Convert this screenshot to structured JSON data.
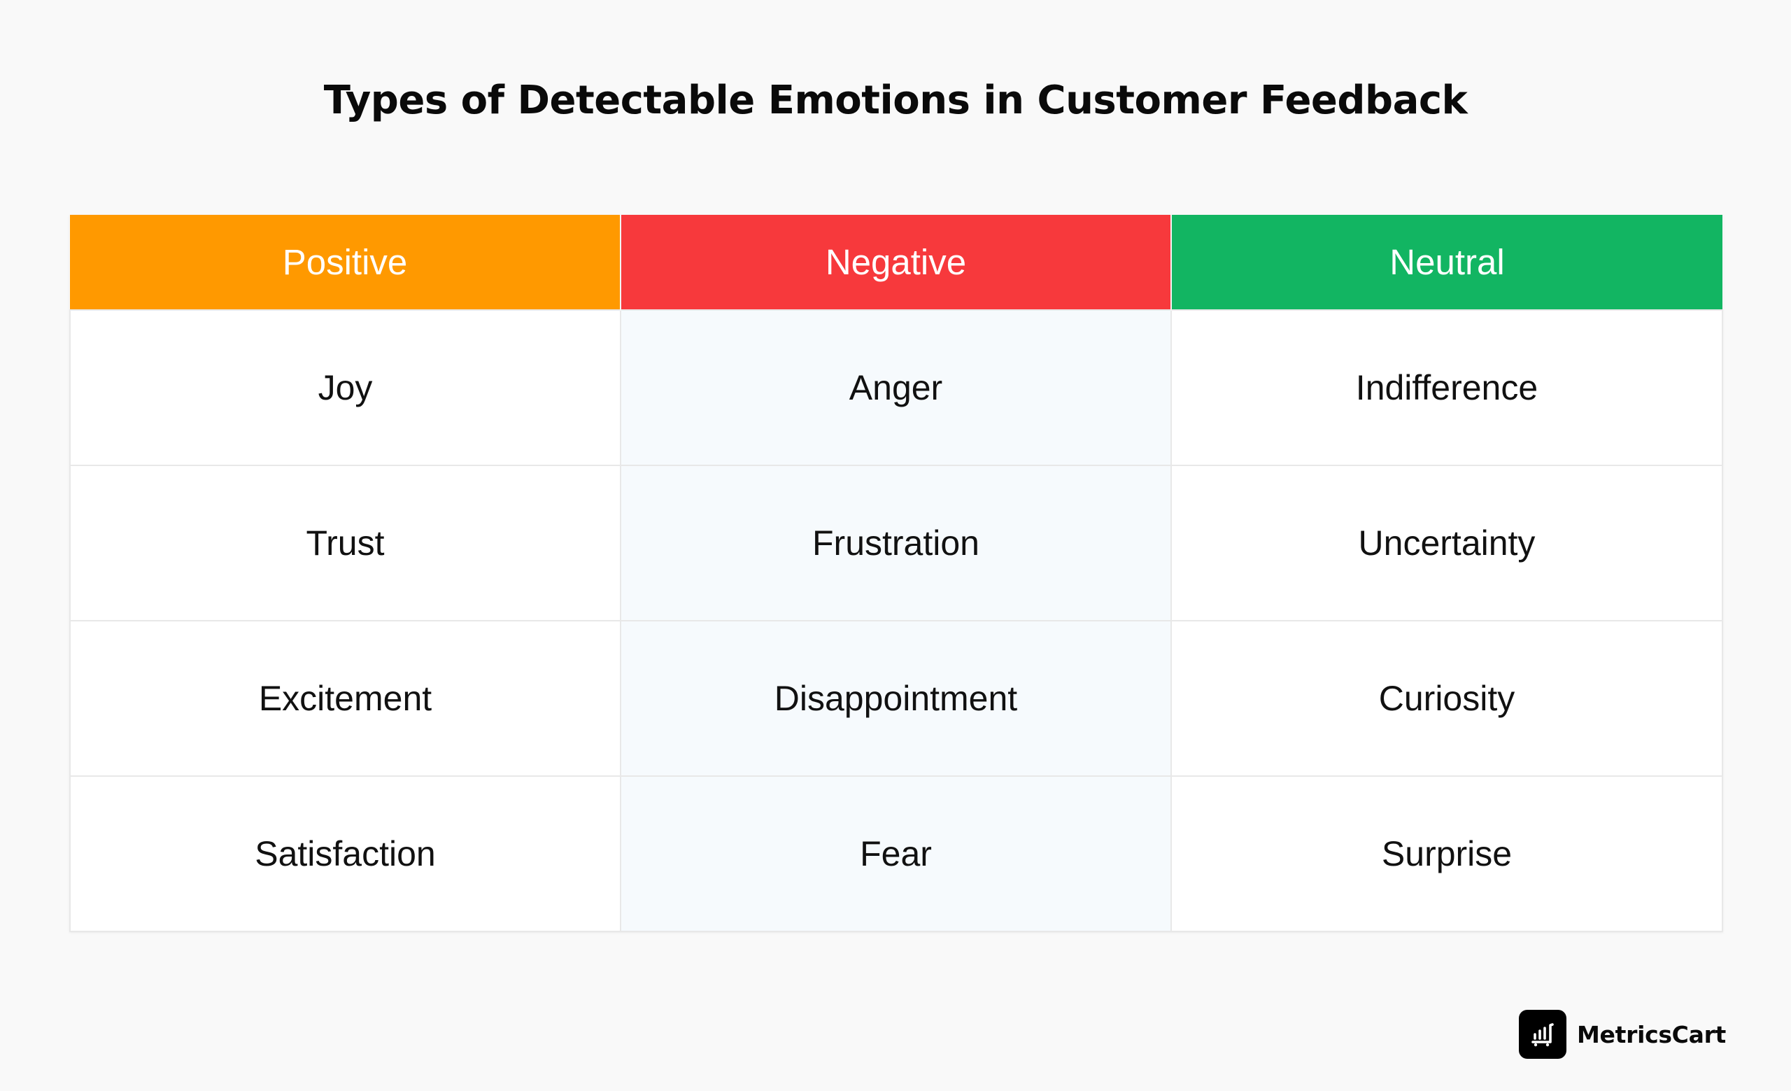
{
  "title": "Types of Detectable Emotions in Customer Feedback",
  "table": {
    "columns": [
      {
        "label": "Positive",
        "color": "#FF9900"
      },
      {
        "label": "Negative",
        "color": "#F7393C"
      },
      {
        "label": "Neutral",
        "color": "#12B562"
      }
    ],
    "rows": [
      [
        "Joy",
        "Anger",
        "Indifference"
      ],
      [
        "Trust",
        "Frustration",
        "Uncertainty"
      ],
      [
        "Excitement",
        "Disappointment",
        "Curiosity"
      ],
      [
        "Satisfaction",
        "Fear",
        "Surprise"
      ]
    ]
  },
  "brand": {
    "name": "MetricsCart",
    "logo_icon": "bar-chart-cart-icon"
  }
}
